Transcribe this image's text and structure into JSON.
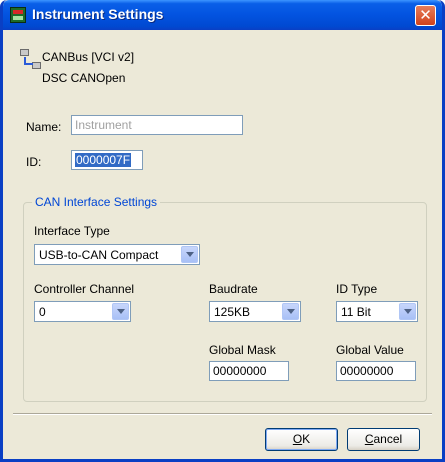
{
  "window": {
    "title": "Instrument Settings",
    "close_symbol": "✕"
  },
  "device": {
    "icon": "network-icon",
    "line1": "CANBus [VCI v2]",
    "line2": "DSC CANOpen"
  },
  "name_field": {
    "label": "Name:",
    "placeholder": "Instrument"
  },
  "id_field": {
    "label": "ID:",
    "value": "0000007F"
  },
  "can_group": {
    "title": "CAN Interface Settings",
    "interface_type": {
      "label": "Interface Type",
      "value": "USB-to-CAN Compact"
    },
    "controller_channel": {
      "label": "Controller Channel",
      "value": "0"
    },
    "baudrate": {
      "label": "Baudrate",
      "value": "125KB"
    },
    "id_type": {
      "label": "ID Type",
      "value": "11 Bit"
    },
    "global_mask": {
      "label": "Global Mask",
      "value": "00000000"
    },
    "global_value": {
      "label": "Global Value",
      "value": "00000000"
    }
  },
  "buttons": {
    "ok_mnemonic": "O",
    "ok_rest": "K",
    "cancel_mnemonic": "C",
    "cancel_rest": "ancel"
  },
  "colors": {
    "titlebar": "#0353e0",
    "dialog_bg": "#ece9d8",
    "group_title": "#0046d5",
    "selection": "#316ac5"
  }
}
